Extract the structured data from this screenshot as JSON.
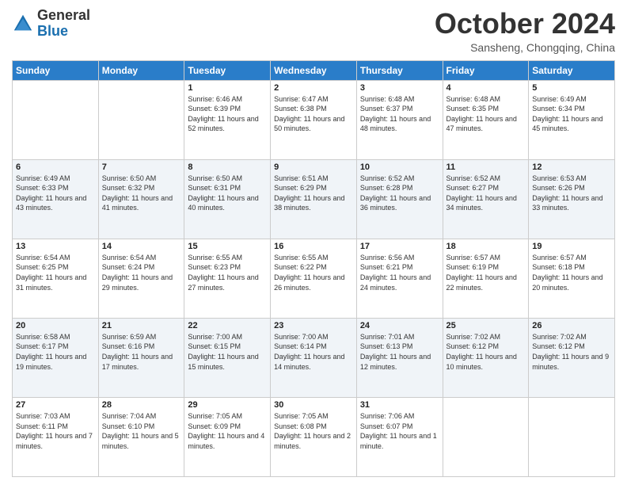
{
  "logo": {
    "general": "General",
    "blue": "Blue"
  },
  "header": {
    "month": "October 2024",
    "location": "Sansheng, Chongqing, China"
  },
  "days_of_week": [
    "Sunday",
    "Monday",
    "Tuesday",
    "Wednesday",
    "Thursday",
    "Friday",
    "Saturday"
  ],
  "weeks": [
    [
      null,
      null,
      {
        "day": 1,
        "sunrise": "6:46 AM",
        "sunset": "6:39 PM",
        "daylight": "11 hours and 52 minutes."
      },
      {
        "day": 2,
        "sunrise": "6:47 AM",
        "sunset": "6:38 PM",
        "daylight": "11 hours and 50 minutes."
      },
      {
        "day": 3,
        "sunrise": "6:48 AM",
        "sunset": "6:37 PM",
        "daylight": "11 hours and 48 minutes."
      },
      {
        "day": 4,
        "sunrise": "6:48 AM",
        "sunset": "6:35 PM",
        "daylight": "11 hours and 47 minutes."
      },
      {
        "day": 5,
        "sunrise": "6:49 AM",
        "sunset": "6:34 PM",
        "daylight": "11 hours and 45 minutes."
      }
    ],
    [
      {
        "day": 6,
        "sunrise": "6:49 AM",
        "sunset": "6:33 PM",
        "daylight": "11 hours and 43 minutes."
      },
      {
        "day": 7,
        "sunrise": "6:50 AM",
        "sunset": "6:32 PM",
        "daylight": "11 hours and 41 minutes."
      },
      {
        "day": 8,
        "sunrise": "6:50 AM",
        "sunset": "6:31 PM",
        "daylight": "11 hours and 40 minutes."
      },
      {
        "day": 9,
        "sunrise": "6:51 AM",
        "sunset": "6:29 PM",
        "daylight": "11 hours and 38 minutes."
      },
      {
        "day": 10,
        "sunrise": "6:52 AM",
        "sunset": "6:28 PM",
        "daylight": "11 hours and 36 minutes."
      },
      {
        "day": 11,
        "sunrise": "6:52 AM",
        "sunset": "6:27 PM",
        "daylight": "11 hours and 34 minutes."
      },
      {
        "day": 12,
        "sunrise": "6:53 AM",
        "sunset": "6:26 PM",
        "daylight": "11 hours and 33 minutes."
      }
    ],
    [
      {
        "day": 13,
        "sunrise": "6:54 AM",
        "sunset": "6:25 PM",
        "daylight": "11 hours and 31 minutes."
      },
      {
        "day": 14,
        "sunrise": "6:54 AM",
        "sunset": "6:24 PM",
        "daylight": "11 hours and 29 minutes."
      },
      {
        "day": 15,
        "sunrise": "6:55 AM",
        "sunset": "6:23 PM",
        "daylight": "11 hours and 27 minutes."
      },
      {
        "day": 16,
        "sunrise": "6:55 AM",
        "sunset": "6:22 PM",
        "daylight": "11 hours and 26 minutes."
      },
      {
        "day": 17,
        "sunrise": "6:56 AM",
        "sunset": "6:21 PM",
        "daylight": "11 hours and 24 minutes."
      },
      {
        "day": 18,
        "sunrise": "6:57 AM",
        "sunset": "6:19 PM",
        "daylight": "11 hours and 22 minutes."
      },
      {
        "day": 19,
        "sunrise": "6:57 AM",
        "sunset": "6:18 PM",
        "daylight": "11 hours and 20 minutes."
      }
    ],
    [
      {
        "day": 20,
        "sunrise": "6:58 AM",
        "sunset": "6:17 PM",
        "daylight": "11 hours and 19 minutes."
      },
      {
        "day": 21,
        "sunrise": "6:59 AM",
        "sunset": "6:16 PM",
        "daylight": "11 hours and 17 minutes."
      },
      {
        "day": 22,
        "sunrise": "7:00 AM",
        "sunset": "6:15 PM",
        "daylight": "11 hours and 15 minutes."
      },
      {
        "day": 23,
        "sunrise": "7:00 AM",
        "sunset": "6:14 PM",
        "daylight": "11 hours and 14 minutes."
      },
      {
        "day": 24,
        "sunrise": "7:01 AM",
        "sunset": "6:13 PM",
        "daylight": "11 hours and 12 minutes."
      },
      {
        "day": 25,
        "sunrise": "7:02 AM",
        "sunset": "6:12 PM",
        "daylight": "11 hours and 10 minutes."
      },
      {
        "day": 26,
        "sunrise": "7:02 AM",
        "sunset": "6:12 PM",
        "daylight": "11 hours and 9 minutes."
      }
    ],
    [
      {
        "day": 27,
        "sunrise": "7:03 AM",
        "sunset": "6:11 PM",
        "daylight": "11 hours and 7 minutes."
      },
      {
        "day": 28,
        "sunrise": "7:04 AM",
        "sunset": "6:10 PM",
        "daylight": "11 hours and 5 minutes."
      },
      {
        "day": 29,
        "sunrise": "7:05 AM",
        "sunset": "6:09 PM",
        "daylight": "11 hours and 4 minutes."
      },
      {
        "day": 30,
        "sunrise": "7:05 AM",
        "sunset": "6:08 PM",
        "daylight": "11 hours and 2 minutes."
      },
      {
        "day": 31,
        "sunrise": "7:06 AM",
        "sunset": "6:07 PM",
        "daylight": "11 hours and 1 minute."
      },
      null,
      null
    ]
  ]
}
